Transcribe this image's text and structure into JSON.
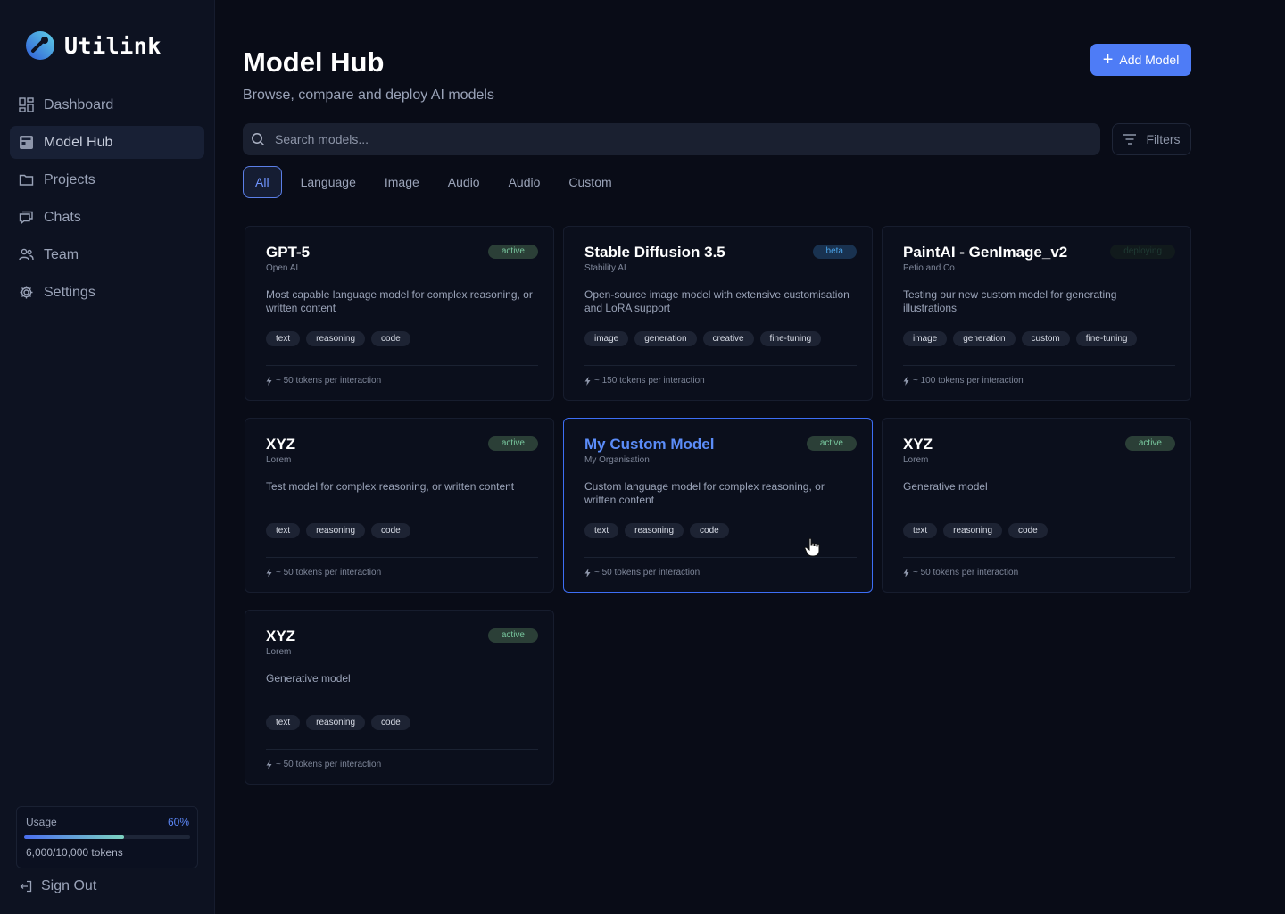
{
  "app": {
    "brand": "Utilink"
  },
  "sidebar": {
    "items": [
      {
        "label": "Dashboard",
        "icon": "grid-icon",
        "active": false
      },
      {
        "label": "Model Hub",
        "icon": "model-hub-icon",
        "active": true
      },
      {
        "label": "Projects",
        "icon": "folder-icon",
        "active": false
      },
      {
        "label": "Chats",
        "icon": "chat-icon",
        "active": false
      },
      {
        "label": "Team",
        "icon": "team-icon",
        "active": false
      },
      {
        "label": "Settings",
        "icon": "gear-icon",
        "active": false
      }
    ],
    "usage": {
      "title": "Usage",
      "percent_label": "60%",
      "fraction": 0.6,
      "tokens_label": "6,000/10,000 tokens"
    },
    "sign_out": "Sign Out"
  },
  "header": {
    "title": "Model Hub",
    "subtitle": "Browse, compare and deploy AI models",
    "add_button": "Add Model"
  },
  "search": {
    "placeholder": "Search models...",
    "value": ""
  },
  "filters_button": "Filters",
  "tabs": [
    "All",
    "Language",
    "Image",
    "Audio",
    "Audio",
    "Custom"
  ],
  "active_tab": "All",
  "colors": {
    "accent": "#4e7cf6",
    "active_badge": "#78c79e",
    "beta_badge": "#4aa3e8",
    "background": "#090c17"
  },
  "models": [
    {
      "name": "GPT-5",
      "org": "Open AI",
      "status": "active",
      "description": "Most capable language model for complex reasoning, or written content",
      "tags": [
        "text",
        "reasoning",
        "code"
      ],
      "tokens": "~ 50 tokens per interaction"
    },
    {
      "name": "Stable Diffusion 3.5",
      "org": "Stability AI",
      "status": "beta",
      "description": "Open-source image model with extensive customisation and LoRA support",
      "tags": [
        "image",
        "generation",
        "creative",
        "fine-tuning"
      ],
      "tokens": "~ 150 tokens per interaction"
    },
    {
      "name": "PaintAI - GenImage_v2",
      "org": "Petio and Co",
      "status": "deploying",
      "description": "Testing our new custom model for generating illustrations",
      "tags": [
        "image",
        "generation",
        "custom",
        "fine-tuning"
      ],
      "tokens": "~ 100 tokens per interaction"
    },
    {
      "name": "XYZ",
      "org": "Lorem",
      "status": "active",
      "description": "Test model for complex reasoning, or written content",
      "tags": [
        "text",
        "reasoning",
        "code"
      ],
      "tokens": "~ 50 tokens per interaction"
    },
    {
      "name": "My Custom Model",
      "org": "My Organisation",
      "status": "active",
      "description": "Custom language model for complex reasoning, or written content",
      "tags": [
        "text",
        "reasoning",
        "code"
      ],
      "tokens": "~ 50 tokens per interaction",
      "selected": true
    },
    {
      "name": "XYZ",
      "org": "Lorem",
      "status": "active",
      "description": "Generative model",
      "tags": [
        "text",
        "reasoning",
        "code"
      ],
      "tokens": "~ 50 tokens per interaction"
    },
    {
      "name": "XYZ",
      "org": "Lorem",
      "status": "active",
      "description": "Generative model",
      "tags": [
        "text",
        "reasoning",
        "code"
      ],
      "tokens": "~ 50 tokens per interaction"
    }
  ]
}
